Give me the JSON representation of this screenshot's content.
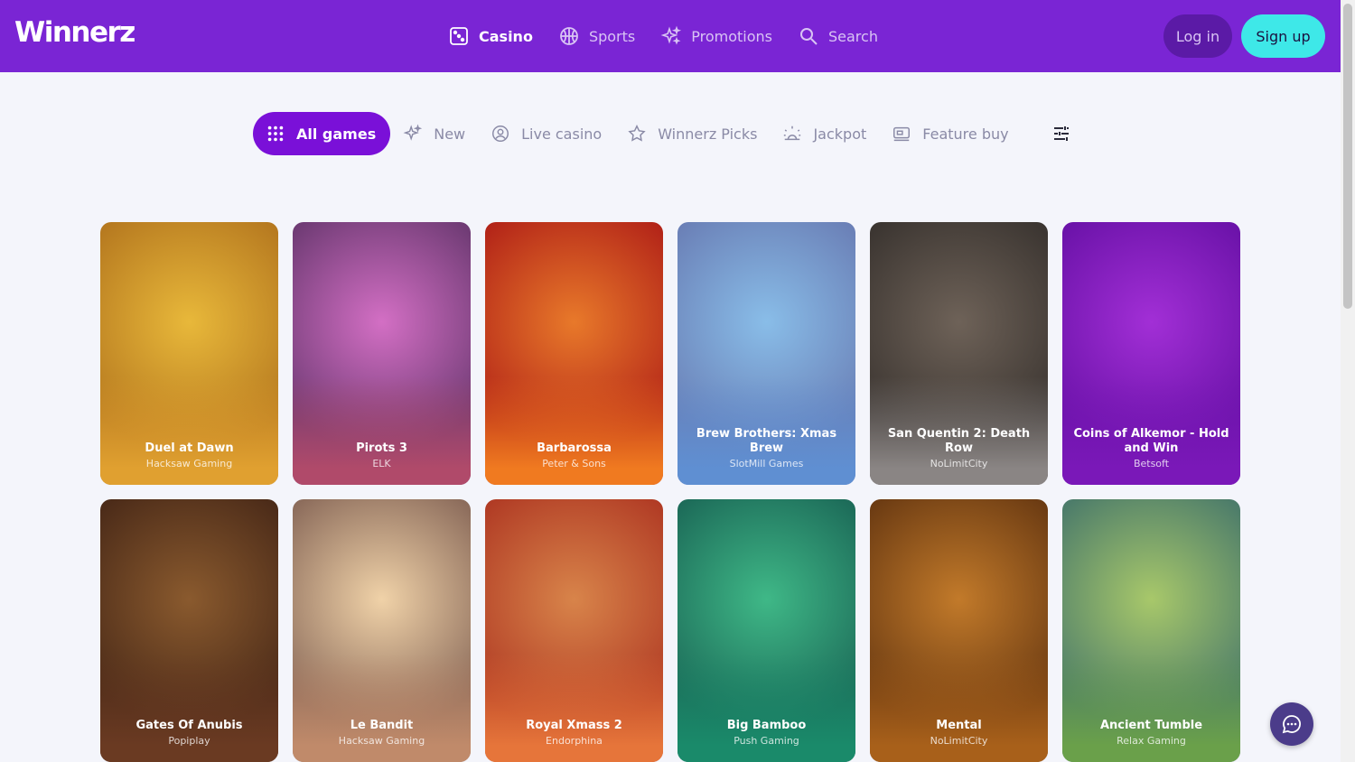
{
  "brand": {
    "logo_text": "Winnerz",
    "primary": "#7a25d4",
    "accent": "#3ee8e8"
  },
  "nav": [
    {
      "label": "Casino",
      "icon": "dice-icon",
      "active": true
    },
    {
      "label": "Sports",
      "icon": "basketball-icon",
      "active": false
    },
    {
      "label": "Promotions",
      "icon": "sparkles-icon",
      "active": false
    },
    {
      "label": "Search",
      "icon": "search-icon",
      "active": false
    }
  ],
  "auth": {
    "login_label": "Log in",
    "signup_label": "Sign up"
  },
  "categories": [
    {
      "label": "All games",
      "icon": "grid-dots-icon",
      "active": true
    },
    {
      "label": "New",
      "icon": "sparkles-icon",
      "active": false
    },
    {
      "label": "Live casino",
      "icon": "user-circle-icon",
      "active": false
    },
    {
      "label": "Winnerz Picks",
      "icon": "star-icon",
      "active": false
    },
    {
      "label": "Jackpot",
      "icon": "sunrise-icon",
      "active": false
    },
    {
      "label": "Feature buy",
      "icon": "ticket-icon",
      "active": false
    }
  ],
  "filter_icon": "sliders-icon",
  "games": [
    {
      "title": "Duel at Dawn",
      "provider": "Hacksaw Gaming",
      "colors": [
        "#e8b83a",
        "#b5781f",
        "#e0a030"
      ]
    },
    {
      "title": "Pirots 3",
      "provider": "ELK",
      "colors": [
        "#d36fc4",
        "#6d3a73",
        "#b04a6a"
      ]
    },
    {
      "title": "Barbarossa",
      "provider": "Peter & Sons",
      "colors": [
        "#e8792a",
        "#b22318",
        "#f07a20"
      ]
    },
    {
      "title": "Brew Brothers: Xmas Brew",
      "provider": "SlotMill Games",
      "colors": [
        "#89bde8",
        "#6a7fb6",
        "#5f8fd2"
      ]
    },
    {
      "title": "San Quentin 2: Death Row",
      "provider": "NoLimitCity",
      "colors": [
        "#6e6258",
        "#3a3430",
        "#8a8584"
      ]
    },
    {
      "title": "Coins of Alkemor - Hold and Win",
      "provider": "Betsoft",
      "colors": [
        "#a22fd6",
        "#6a12a8",
        "#7a18b8"
      ]
    },
    {
      "title": "Gates Of Anubis",
      "provider": "Popiplay",
      "colors": [
        "#8a5a2e",
        "#4a2a18",
        "#6a3a22"
      ]
    },
    {
      "title": "Le Bandit",
      "provider": "Hacksaw Gaming",
      "colors": [
        "#f0d2a8",
        "#8a6a5a",
        "#c08a6a"
      ]
    },
    {
      "title": "Royal Xmass 2",
      "provider": "Endorphina",
      "colors": [
        "#d8844a",
        "#b03a24",
        "#e6753a"
      ]
    },
    {
      "title": "Big Bamboo",
      "provider": "Push Gaming",
      "colors": [
        "#3fb887",
        "#1c6a58",
        "#1a8a6a"
      ]
    },
    {
      "title": "Mental",
      "provider": "NoLimitCity",
      "colors": [
        "#c27a2a",
        "#6a3a12",
        "#a8601a"
      ]
    },
    {
      "title": "Ancient Tumble",
      "provider": "Relax Gaming",
      "colors": [
        "#a8c86a",
        "#4a7a6a",
        "#6aa04a"
      ]
    }
  ],
  "chat_icon": "chat-bubble-icon"
}
